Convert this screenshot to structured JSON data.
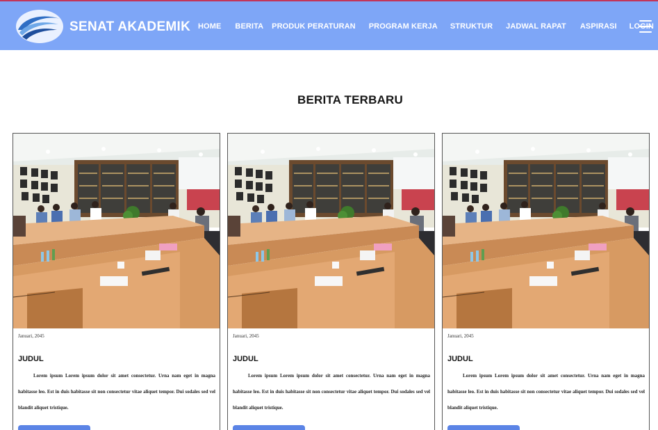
{
  "header": {
    "brand_name": "SENAT AKADEMIK",
    "logo_icon": "senat-wave-logo",
    "menu_icon": "hamburger-icon",
    "menu": [
      {
        "label": "HOME"
      },
      {
        "label": "BERITA"
      },
      {
        "label": "PRODUK PERATURAN"
      },
      {
        "label": "PROGRAM KERJA"
      },
      {
        "label": "STRUKTUR"
      },
      {
        "label": "JADWAL RAPAT"
      },
      {
        "label": "ASPIRASI"
      },
      {
        "label": "LOGIN"
      }
    ],
    "colors": {
      "background": "#7ea6f7",
      "text": "#ffffff"
    }
  },
  "main": {
    "section_title": "BERITA TERBARU",
    "cards": [
      {
        "image": "meeting-room-photo",
        "date": "Januari, 2045",
        "title": "JUDUL",
        "body": "Lorem ipsum Lorem ipsum dolor sit amet consectetur. Urna nam eget in magna habitasse leo. Est in duis habitasse sit non consectetur vitae aliquet tempor. Dui sodales sed vel blandit aliquet tristique."
      },
      {
        "image": "meeting-room-photo",
        "date": "Januari, 2045",
        "title": "JUDUL",
        "body": "Lorem ipsum Lorem ipsum dolor sit amet consectetur. Urna nam eget in magna habitasse leo. Est in duis habitasse sit non consectetur vitae aliquet tempor. Dui sodales sed vel blandit aliquet tristique."
      },
      {
        "image": "meeting-room-photo",
        "date": "Januari, 2045",
        "title": "JUDUL",
        "body": "Lorem ipsum Lorem ipsum dolor sit amet consectetur. Urna nam eget in magna habitasse leo. Est in duis habitasse sit non consectetur vitae aliquet tempor. Dui sodales sed vel blandit aliquet tristique."
      }
    ],
    "colors": {
      "button": "#5b84e6",
      "accent_line": "#c2355a"
    }
  }
}
